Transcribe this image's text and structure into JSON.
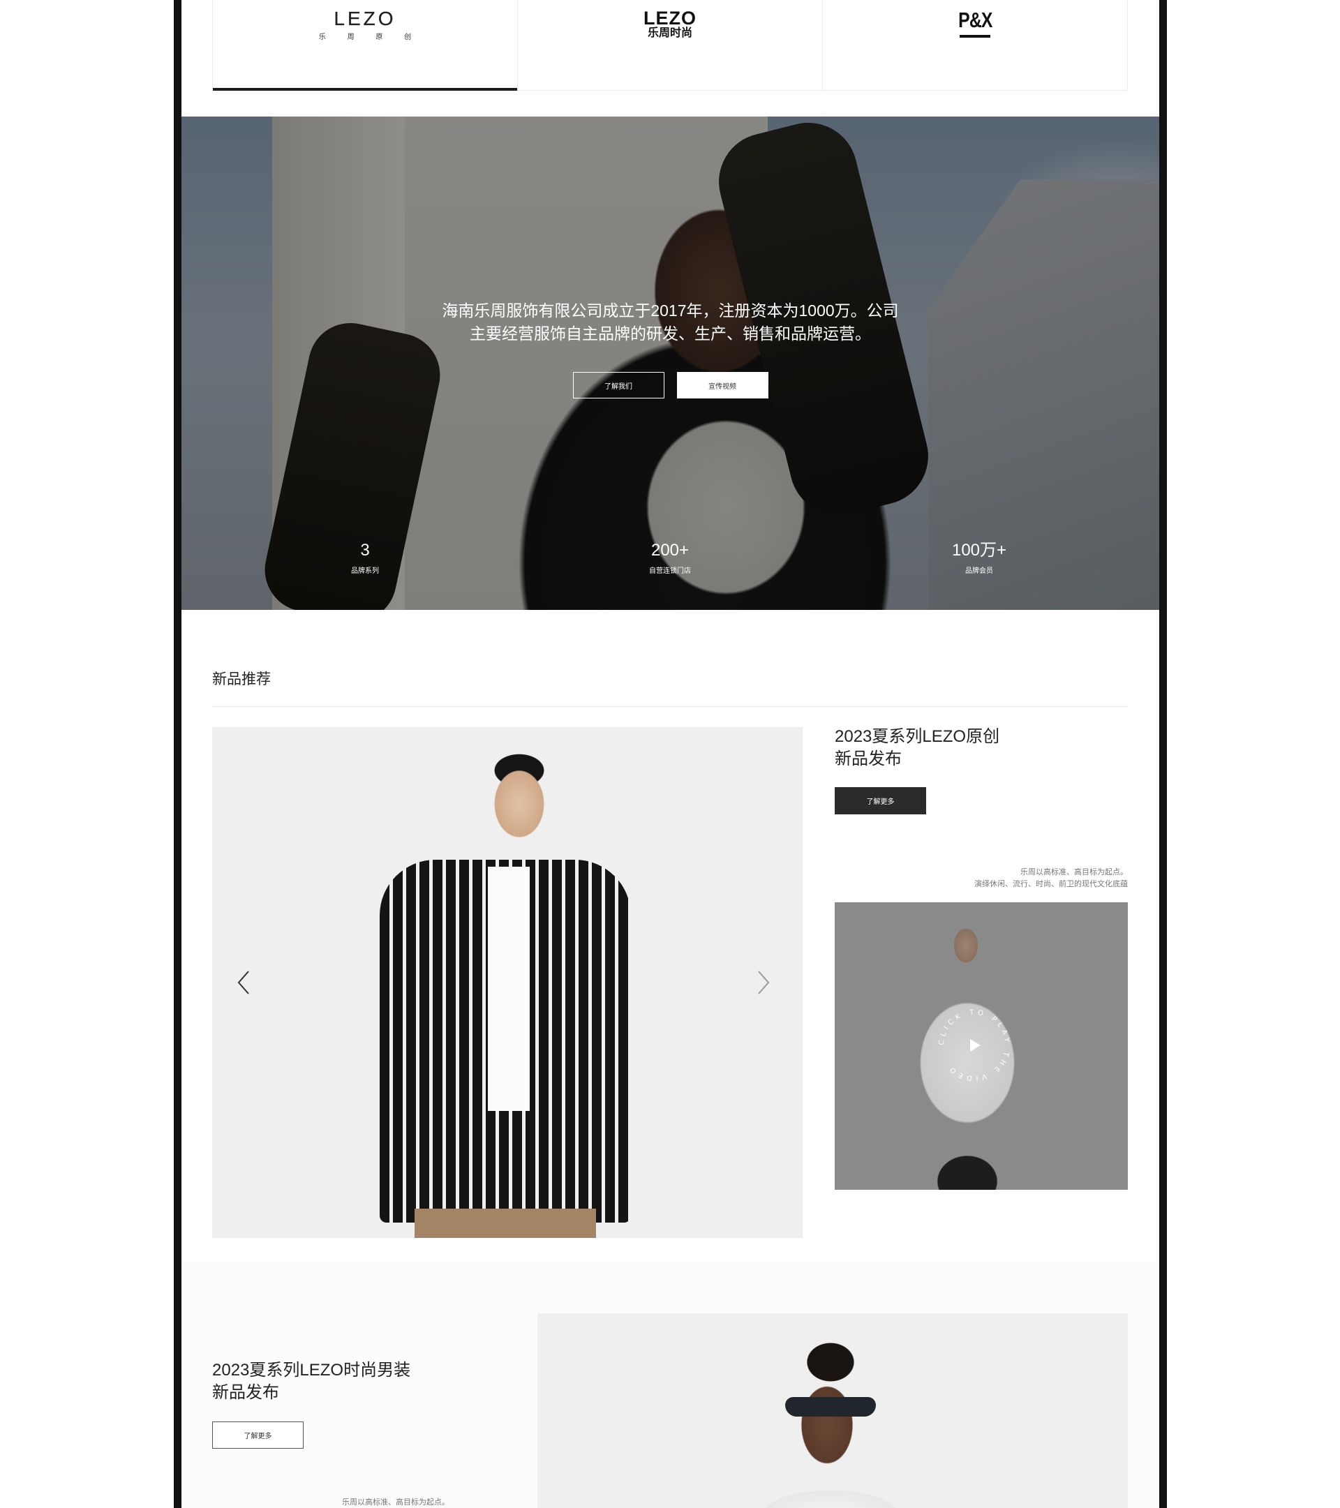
{
  "brand_tabs": [
    {
      "name": "LEZO",
      "sub": "乐 周 原 创",
      "style": "outline",
      "active": true
    },
    {
      "name": "LEZO",
      "sub": "乐周时尚",
      "style": "bold",
      "active": false
    },
    {
      "name": "P&X",
      "sub": "",
      "style": "px",
      "active": false
    }
  ],
  "hero": {
    "line1": "海南乐周服饰有限公司成立于2017年，注册资本为1000万。公司",
    "line2": "主要经营服饰自主品牌的研发、生产、销售和品牌运营。",
    "about_button": "了解我们",
    "video_button": "宣传视频",
    "stats": [
      {
        "value": "3",
        "label": "品牌系列"
      },
      {
        "value": "200+",
        "label": "自营连锁门店"
      },
      {
        "value": "100万+",
        "label": "品牌会员"
      }
    ]
  },
  "new_products": {
    "title": "新品推荐",
    "feature_title_line1": "2023夏系列LEZO原创",
    "feature_title_line2": "新品发布",
    "more_button": "了解更多",
    "desc_line1": "乐周以高标准、高目标为起点。",
    "desc_line2": "演绎休闲、流行、时尚、前卫的现代文化底蕴",
    "video_ring_text": "CLICK TO PLAY THE VIDEO"
  },
  "feature2": {
    "title_line1": "2023夏系列LEZO时尚男装",
    "title_line2": "新品发布",
    "more_button": "了解更多",
    "desc": "乐周以高标准、高目标为起点。"
  },
  "colors": {
    "dark_button": "#2b2b2b",
    "frame": "#111111",
    "active_tab_underline": "#1c1c1c"
  }
}
